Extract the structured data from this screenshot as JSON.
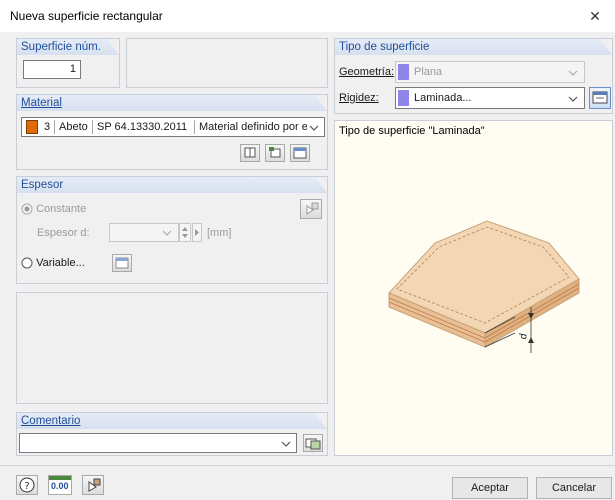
{
  "window": {
    "title": "Nueva superficie rectangular",
    "close_glyph": "✕"
  },
  "surface": {
    "header": "Superficie núm.",
    "number": "1"
  },
  "material": {
    "header": "Material",
    "index": "3",
    "name": "Abeto",
    "norm": "SP 64.13330.2011",
    "source": "Material definido por el",
    "color": "#e06a0a"
  },
  "thickness": {
    "header": "Espesor",
    "constant_label": "Constante",
    "thickness_label": "Espesor d:",
    "unit": "[mm]",
    "variable_label": "Variable..."
  },
  "comment": {
    "header": "Comentario",
    "value": ""
  },
  "surface_type": {
    "header": "Tipo de superficie",
    "geometry_label": "Geometría:",
    "geometry_value": "Plana",
    "geometry_color": "#8f85e8",
    "stiffness_label": "Rigidez:",
    "stiffness_value": "Laminada...",
    "stiffness_color": "#8f85e8"
  },
  "preview": {
    "caption": "Tipo de superficie \"Laminada\"",
    "dim_label": "d"
  },
  "footer": {
    "decimal_icon_text": "0.00",
    "ok_label": "Aceptar",
    "cancel_label": "Cancelar"
  }
}
